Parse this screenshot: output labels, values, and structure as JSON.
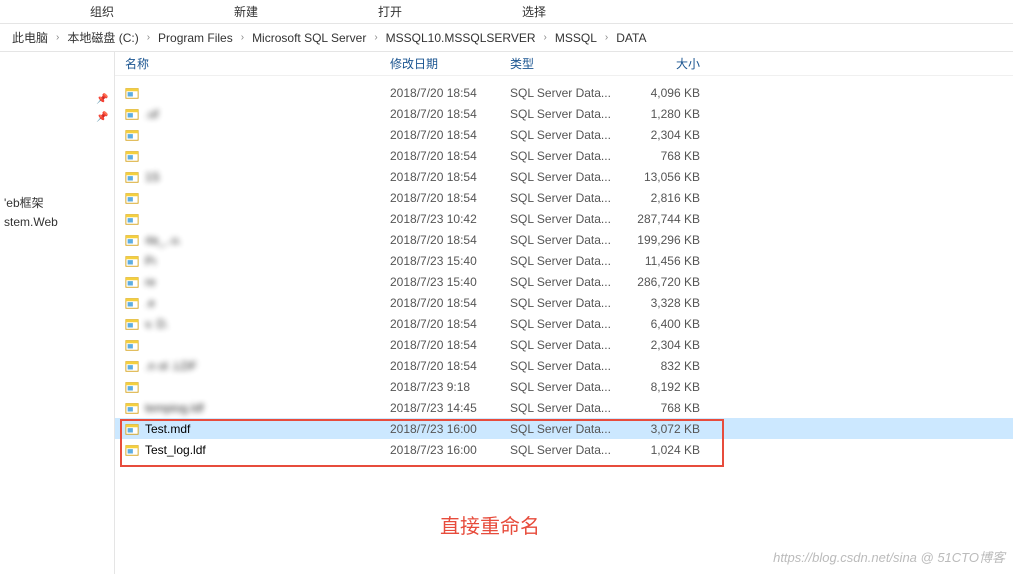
{
  "toolbar": {
    "organize": "组织",
    "new": "新建",
    "open": "打开",
    "select": "选择"
  },
  "breadcrumb": [
    "此电脑",
    "本地磁盘 (C:)",
    "Program Files",
    "Microsoft SQL Server",
    "MSSQL10.MSSQLSERVER",
    "MSSQL",
    "DATA"
  ],
  "sidebar": {
    "web_framework": "'eb框架",
    "system_web": "stem.Web"
  },
  "headers": {
    "name": "名称",
    "modified": "修改日期",
    "type": "类型",
    "size": "大小"
  },
  "files": [
    {
      "name": "",
      "date": "2018/7/20 18:54",
      "type": "SQL Server Data...",
      "size": "4,096 KB",
      "blurred": true
    },
    {
      "name": ".uf",
      "date": "2018/7/20 18:54",
      "type": "SQL Server Data...",
      "size": "1,280 KB",
      "blurred": true
    },
    {
      "name": "",
      "date": "2018/7/20 18:54",
      "type": "SQL Server Data...",
      "size": "2,304 KB",
      "blurred": true
    },
    {
      "name": "",
      "date": "2018/7/20 18:54",
      "type": "SQL Server Data...",
      "size": "768 KB",
      "blurred": true
    },
    {
      "name": "1S",
      "date": "2018/7/20 18:54",
      "type": "SQL Server Data...",
      "size": "13,056 KB",
      "blurred": true
    },
    {
      "name": "",
      "date": "2018/7/20 18:54",
      "type": "SQL Server Data...",
      "size": "2,816 KB",
      "blurred": true
    },
    {
      "name": "",
      "date": "2018/7/23 10:42",
      "type": "SQL Server Data...",
      "size": "287,744 KB",
      "blurred": true
    },
    {
      "name": "ıta_..u.",
      "date": "2018/7/20 18:54",
      "type": "SQL Server Data...",
      "size": "199,296 KB",
      "blurred": true
    },
    {
      "name": "Pı",
      "date": "2018/7/23 15:40",
      "type": "SQL Server Data...",
      "size": "11,456 KB",
      "blurred": true
    },
    {
      "name": "re",
      "date": "2018/7/23 15:40",
      "type": "SQL Server Data...",
      "size": "286,720 KB",
      "blurred": true
    },
    {
      "name": ".e",
      "date": "2018/7/20 18:54",
      "type": "SQL Server Data...",
      "size": "3,328 KB",
      "blurred": true
    },
    {
      "name": "v. D.",
      "date": "2018/7/20 18:54",
      "type": "SQL Server Data...",
      "size": "6,400 KB",
      "blurred": true
    },
    {
      "name": "",
      "date": "2018/7/20 18:54",
      "type": "SQL Server Data...",
      "size": "2,304 KB",
      "blurred": true
    },
    {
      "name": ".n ol  .LDF",
      "date": "2018/7/20 18:54",
      "type": "SQL Server Data...",
      "size": "832 KB",
      "blurred": true
    },
    {
      "name": "",
      "date": "2018/7/23 9:18",
      "type": "SQL Server Data...",
      "size": "8,192 KB",
      "blurred": true
    },
    {
      "name": "tempiog.ldf",
      "date": "2018/7/23 14:45",
      "type": "SQL Server Data...",
      "size": "768 KB",
      "blurred": true
    },
    {
      "name": "Test.mdf",
      "date": "2018/7/23 16:00",
      "type": "SQL Server Data...",
      "size": "3,072 KB",
      "blurred": false,
      "highlighted": true
    },
    {
      "name": "Test_log.ldf",
      "date": "2018/7/23 16:00",
      "type": "SQL Server Data...",
      "size": "1,024 KB",
      "blurred": false
    }
  ],
  "annotation": "直接重命名",
  "watermark": "https://blog.csdn.net/sina @ 51CTO博客"
}
